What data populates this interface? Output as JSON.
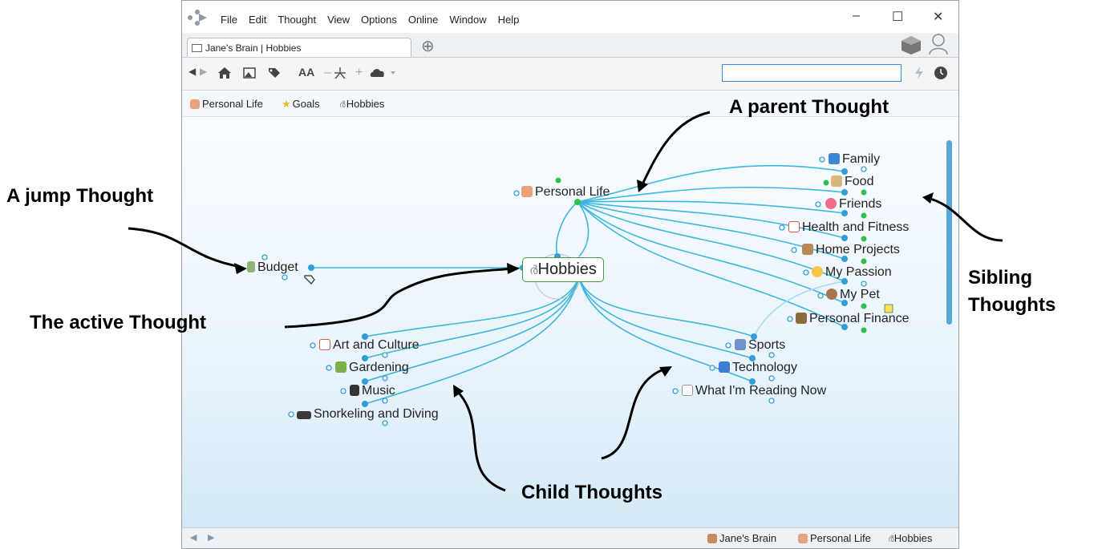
{
  "window": {
    "menu": [
      "File",
      "Edit",
      "Thought",
      "View",
      "Options",
      "Online",
      "Window",
      "Help"
    ],
    "tab_label": "Jane's Brain | Hobbies",
    "new_tab": "⊕",
    "controls": {
      "minimize": "–",
      "maximize": "☐",
      "close": "✕"
    }
  },
  "toolbar": {
    "back": "◀",
    "forward": "▶",
    "home": "⌂",
    "font": "AA",
    "minus": "–",
    "plus": "+",
    "search_value": "",
    "icons": [
      "back-icon",
      "forward-icon",
      "home-icon",
      "image-icon",
      "tag-icon",
      "font-size-icon",
      "layout-icon",
      "cloud-icon",
      "lightning-icon",
      "clock-icon"
    ]
  },
  "pins": [
    {
      "label": "Personal Life",
      "icon": "person-icon"
    },
    {
      "label": "Goals",
      "icon": "star-icon"
    },
    {
      "label": "Hobbies",
      "icon": "bicycle-icon"
    }
  ],
  "map": {
    "active": "Hobbies",
    "parent": "Personal Life",
    "jump": "Budget",
    "siblings": [
      "Family",
      "Food",
      "Friends",
      "Health and Fitness",
      "Home Projects",
      "My Passion",
      "My Pet",
      "Personal Finance"
    ],
    "children_left": [
      "Art and Culture",
      "Gardening",
      "Music",
      "Snorkeling and Diving"
    ],
    "children_right": [
      "Sports",
      "Technology",
      "What I'm Reading Now"
    ]
  },
  "statusbar": {
    "nav_back": "◀",
    "nav_forward": "▶",
    "crumbs": [
      "Jane's Brain",
      "Personal Life",
      "Hobbies"
    ]
  },
  "annotations": {
    "parent": "A parent Thought",
    "jump": "A jump Thought",
    "active": "The active Thought",
    "siblings_line1": "Sibling",
    "siblings_line2": "Thoughts",
    "children": "Child Thoughts"
  },
  "colors": {
    "link": "#3eb7de",
    "active_border": "#3d9a48",
    "accent": "#3a87d8"
  }
}
